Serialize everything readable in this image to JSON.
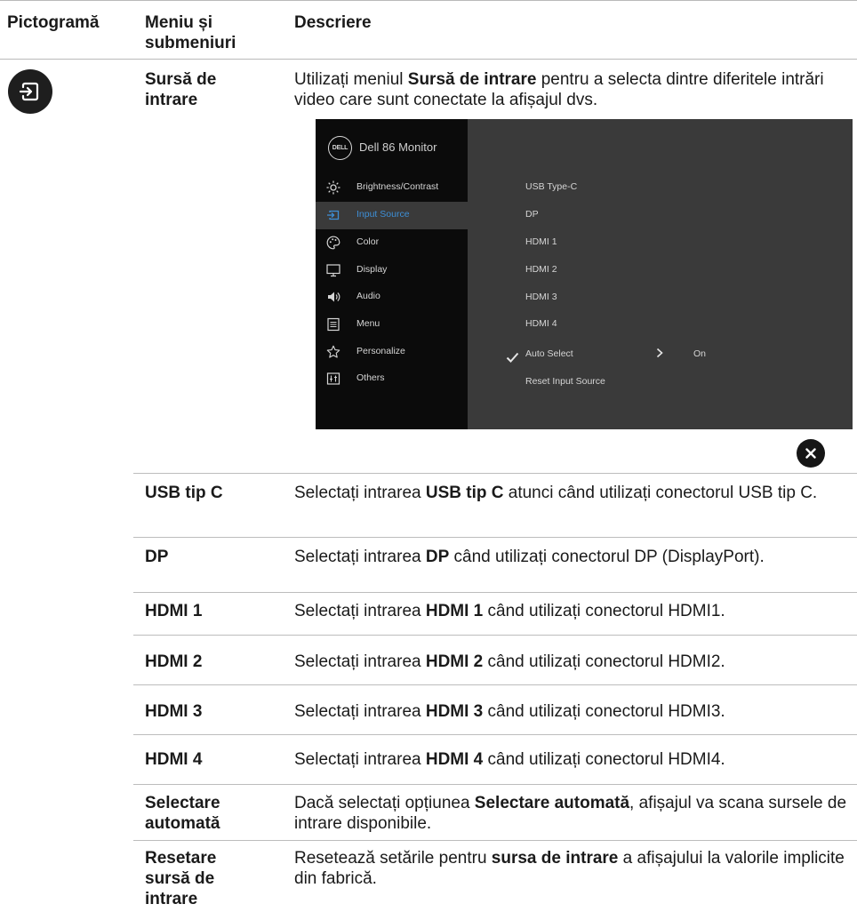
{
  "header": {
    "col_icon": "Pictogramă",
    "col_menu_line1": "Meniu și",
    "col_menu_line2": "submeniuri",
    "col_desc": "Descriere"
  },
  "menu": {
    "icon": "input-source-icon",
    "name_line1": "Sursă de",
    "name_line2": "intrare",
    "desc_pre": "Utilizați meniul ",
    "desc_bold": "Sursă de intrare",
    "desc_post": " pentru a selecta dintre diferitele intrări video care sunt conectate la afișajul dvs."
  },
  "osd": {
    "logo": "DELL",
    "title": "Dell 86 Monitor",
    "menu_items": [
      {
        "label": "Brightness/Contrast",
        "icon": "brightness-icon"
      },
      {
        "label": "Input Source",
        "icon": "input-source-icon"
      },
      {
        "label": "Color",
        "icon": "color-palette-icon"
      },
      {
        "label": "Display",
        "icon": "monitor-icon"
      },
      {
        "label": "Audio",
        "icon": "speaker-icon"
      },
      {
        "label": "Menu",
        "icon": "menu-list-icon"
      },
      {
        "label": "Personalize",
        "icon": "star-icon"
      },
      {
        "label": "Others",
        "icon": "others-icon"
      }
    ],
    "active_item": "Input Source",
    "options": [
      "USB Type-C",
      "DP",
      "HDMI 1",
      "HDMI 2",
      "HDMI 3",
      "HDMI 4",
      "Auto Select",
      "Reset Input Source"
    ],
    "selected_option": "HDMI 1",
    "auto_select_value": "On",
    "accent_color": "#3e8fd6"
  },
  "rows": [
    {
      "label_lines": [
        "USB tip C"
      ],
      "pre": "Selectați intrarea ",
      "bold": "USB tip C",
      "post": " atunci când utilizați conectorul USB tip C."
    },
    {
      "label_lines": [
        "DP"
      ],
      "pre": "Selectați intrarea ",
      "bold": "DP",
      "post": " când utilizați conectorul DP (DisplayPort)."
    },
    {
      "label_lines": [
        "HDMI 1"
      ],
      "pre": "Selectați intrarea ",
      "bold": "HDMI 1",
      "post": " când utilizați conectorul HDMI1."
    },
    {
      "label_lines": [
        "HDMI 2"
      ],
      "pre": "Selectați intrarea ",
      "bold": "HDMI 2",
      "post": " când utilizați conectorul HDMI2."
    },
    {
      "label_lines": [
        "HDMI 3"
      ],
      "pre": "Selectați intrarea ",
      "bold": "HDMI 3",
      "post": " când utilizați conectorul HDMI3."
    },
    {
      "label_lines": [
        "HDMI 4"
      ],
      "pre": "Selectați intrarea ",
      "bold": "HDMI 4",
      "post": " când utilizați conectorul HDMI4."
    },
    {
      "label_lines": [
        "Selectare",
        "automată"
      ],
      "pre": "Dacă selectați opțiunea ",
      "bold": "Selectare automată",
      "post": ", afișajul va scana sursele de intrare disponibile."
    },
    {
      "label_lines": [
        "Resetare",
        "sursă de",
        "intrare"
      ],
      "pre": "Resetează setările pentru ",
      "bold": "sursa de intrare",
      "post": " a afișajului la valorile implicite din fabrică."
    }
  ]
}
